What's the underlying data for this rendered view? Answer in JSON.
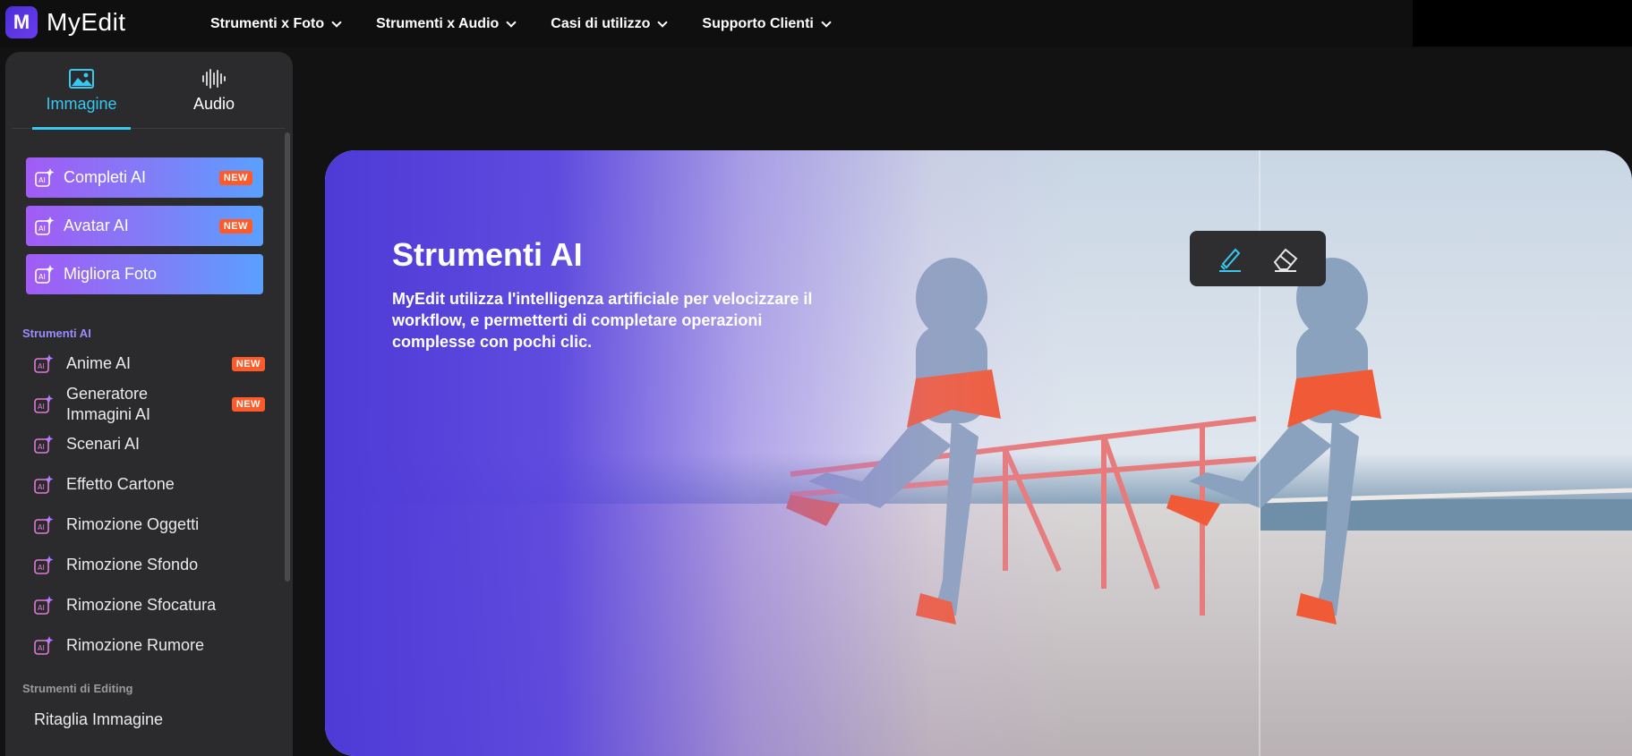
{
  "app": {
    "logo_letter": "M",
    "name": "MyEdit"
  },
  "nav": [
    {
      "label": "Strumenti x Foto"
    },
    {
      "label": "Strumenti x Audio"
    },
    {
      "label": "Casi di utilizzo"
    },
    {
      "label": "Supporto Clienti"
    }
  ],
  "sidebar": {
    "tabs": [
      {
        "label": "Immagine",
        "icon": "image-icon",
        "active": true
      },
      {
        "label": "Audio",
        "icon": "audio-wave-icon",
        "active": false
      }
    ],
    "promos": [
      {
        "label": "Completi AI",
        "badge": "NEW"
      },
      {
        "label": "Avatar AI",
        "badge": "NEW"
      },
      {
        "label": "Migliora Foto",
        "badge": ""
      }
    ],
    "sections": {
      "ai_tools_title": "Strumenti AI",
      "editing_tools_title": "Strumenti di Editing"
    },
    "ai_tools": [
      {
        "label": "Anime AI",
        "badge": "NEW"
      },
      {
        "label": "Generatore Immagini AI",
        "badge": "NEW"
      },
      {
        "label": "Scenari AI",
        "badge": ""
      },
      {
        "label": "Effetto Cartone",
        "badge": ""
      },
      {
        "label": "Rimozione Oggetti",
        "badge": ""
      },
      {
        "label": "Rimozione Sfondo",
        "badge": ""
      },
      {
        "label": "Rimozione Sfocatura",
        "badge": ""
      },
      {
        "label": "Rimozione Rumore",
        "badge": ""
      }
    ],
    "editing_tools": [
      {
        "label": "Ritaglia Immagine"
      }
    ]
  },
  "hero": {
    "title": "Strumenti AI",
    "description": "MyEdit utilizza l'intelligenza artificiale per velocizzare il workflow, e permetterti di completare operazioni complesse con pochi clic.",
    "tools": [
      {
        "icon": "brush-icon"
      },
      {
        "icon": "eraser-icon"
      }
    ]
  },
  "colors": {
    "accent": "#38c8f0",
    "badge": "#ff5a2a",
    "hero_purple": "#4e3ad6",
    "section_purple": "#9b8cff"
  }
}
